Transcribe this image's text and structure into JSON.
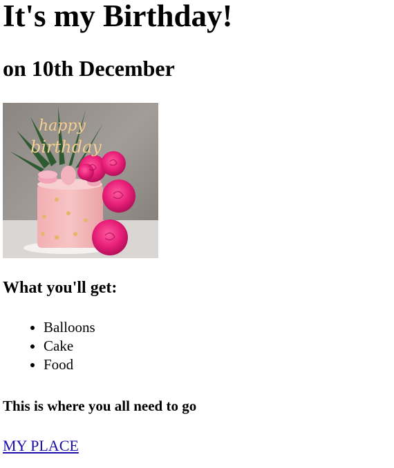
{
  "heading": {
    "title": "It's my Birthday!",
    "date": "on 10th December"
  },
  "image": {
    "description_icon": "birthday-cake-image",
    "topper_line1": "happy",
    "topper_line2": "birthday"
  },
  "gifts": {
    "heading": "What you'll get:",
    "items": [
      "Balloons",
      "Cake",
      "Food"
    ]
  },
  "location": {
    "heading": "This is where you all need to go",
    "link_text": "MY PLACE"
  },
  "colors": {
    "link": "#1a0dab",
    "text": "#000000"
  }
}
